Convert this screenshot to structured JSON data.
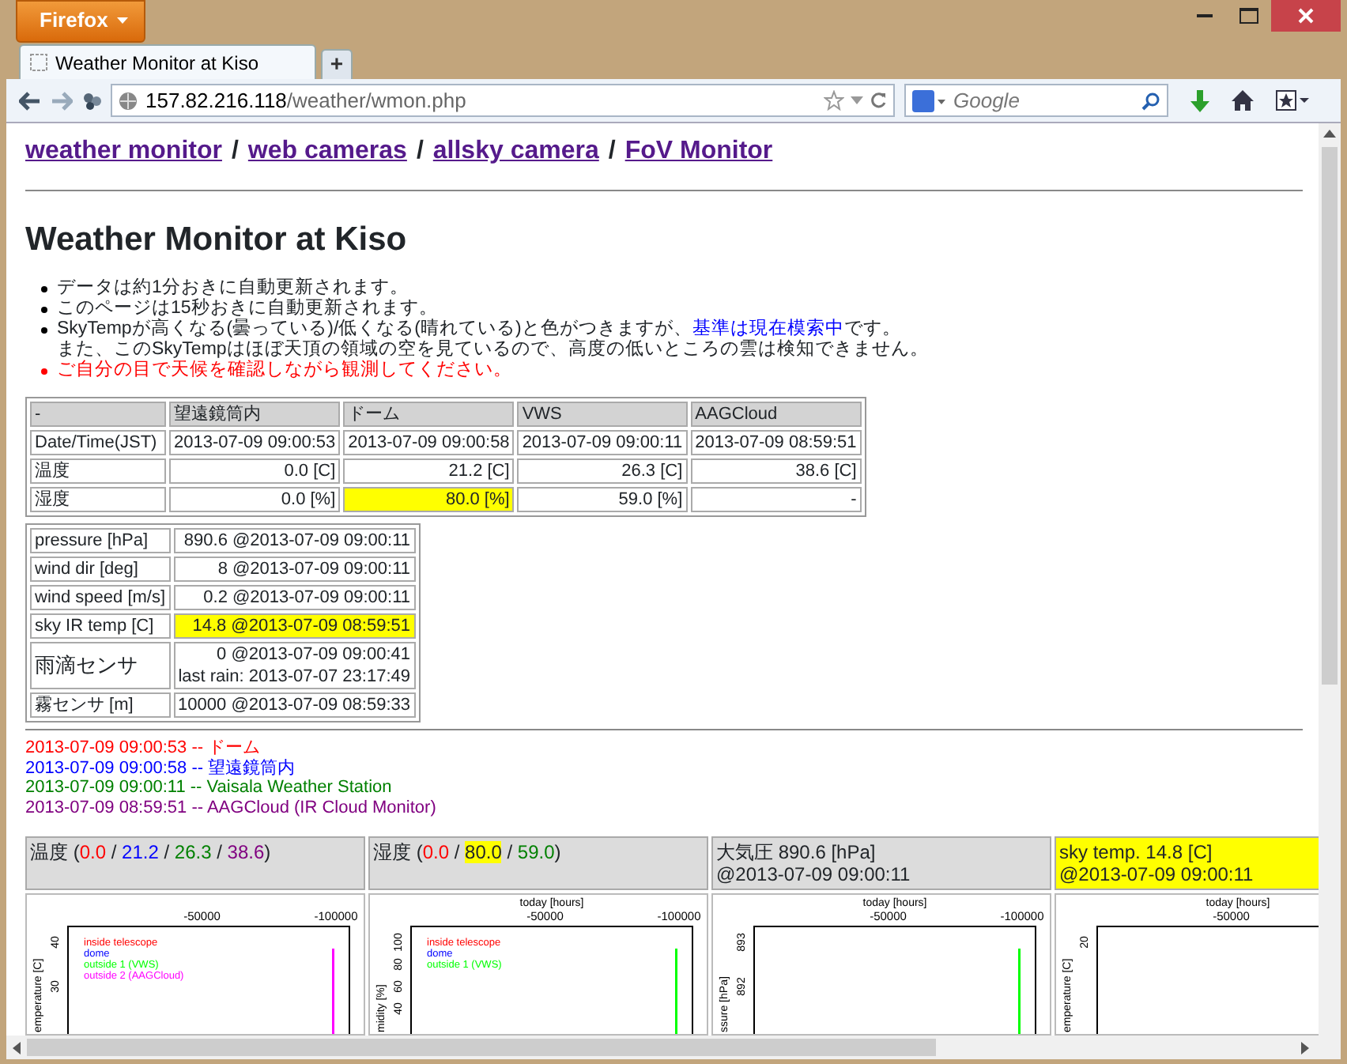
{
  "browser": {
    "menu_button": "Firefox",
    "tab": {
      "title": "Weather Monitor at Kiso",
      "selected": true
    },
    "new_tab": "+",
    "url_host": "157.82.216.118",
    "url_path": "/weather/wmon.php",
    "search_placeholder": "Google"
  },
  "nav": [
    {
      "kind": "link",
      "text": "weather monitor"
    },
    {
      "kind": "separator",
      "text": "/"
    },
    {
      "kind": "link",
      "text": "web cameras"
    },
    {
      "kind": "separator",
      "text": "/"
    },
    {
      "kind": "link",
      "text": "allsky camera"
    },
    {
      "kind": "separator",
      "text": "/"
    },
    {
      "kind": "link",
      "text": "FoV Monitor"
    }
  ],
  "heading": "Weather Monitor at Kiso",
  "notes": [
    {
      "kind": "plain",
      "lines": [
        [
          {
            "kind": "text",
            "text": "データは約1分おきに自動更新されます。"
          }
        ]
      ]
    },
    {
      "kind": "plain",
      "lines": [
        [
          {
            "kind": "text",
            "text": "このページは15秒おきに自動更新されます。"
          }
        ]
      ]
    },
    {
      "kind": "plain",
      "lines": [
        [
          {
            "kind": "text",
            "text": "SkyTempが高くなる(曇っている)/低くなる(晴れている)と色がつきますが、"
          },
          {
            "kind": "link",
            "text": "基準は現在模索中"
          },
          {
            "kind": "text",
            "text": "です。"
          }
        ],
        [
          {
            "kind": "text",
            "text": "また、このSkyTempはほぼ天頂の領域の空を見ているので、高度の低いところの雲は検知できません。"
          }
        ]
      ]
    },
    {
      "kind": "warning",
      "lines": [
        [
          {
            "kind": "text",
            "text": "ご自分の目で天候を確認しながら観測してください。"
          }
        ]
      ]
    }
  ],
  "sensor_table": {
    "columns": [
      "-",
      "望遠鏡筒内",
      "ドーム",
      "VWS",
      "AAGCloud"
    ],
    "rows": [
      {
        "cells": [
          {
            "text": "Date/Time(JST)",
            "highlighted": false
          },
          {
            "text": "2013-07-09 09:00:53",
            "highlighted": false
          },
          {
            "text": "2013-07-09 09:00:58",
            "highlighted": false
          },
          {
            "text": "2013-07-09 09:00:11",
            "highlighted": false
          },
          {
            "text": "2013-07-09 08:59:51",
            "highlighted": false
          }
        ]
      },
      {
        "cells": [
          {
            "text": "温度",
            "highlighted": false
          },
          {
            "text": "0.0 [C]",
            "highlighted": false
          },
          {
            "text": "21.2 [C]",
            "highlighted": false
          },
          {
            "text": "26.3 [C]",
            "highlighted": false
          },
          {
            "text": "38.6 [C]",
            "highlighted": false
          }
        ]
      },
      {
        "cells": [
          {
            "text": "湿度",
            "highlighted": false
          },
          {
            "text": "0.0 [%]",
            "highlighted": false
          },
          {
            "text": "80.0 [%]",
            "highlighted": true
          },
          {
            "text": "59.0 [%]",
            "highlighted": false
          },
          {
            "text": "-",
            "highlighted": false
          }
        ]
      }
    ]
  },
  "station_table": [
    {
      "label": "pressure [hPa]",
      "value": [
        "890.6 @2013-07-09 09:00:11"
      ],
      "highlighted": false
    },
    {
      "label": "wind dir [deg]",
      "value": [
        "8 @2013-07-09 09:00:11"
      ],
      "highlighted": false
    },
    {
      "label": "wind speed [m/s]",
      "value": [
        "0.2 @2013-07-09 09:00:11"
      ],
      "highlighted": false
    },
    {
      "label": "sky IR temp [C]",
      "value": [
        "14.8 @2013-07-09 08:59:51"
      ],
      "highlighted": true
    },
    {
      "label": "雨滴センサ",
      "value": [
        "0 @2013-07-09 09:00:41",
        "last rain: 2013-07-07 23:17:49"
      ],
      "highlighted": false
    },
    {
      "label": "霧センサ [m]",
      "value": [
        "10000 @2013-07-09 08:59:33"
      ],
      "highlighted": false
    }
  ],
  "log": [
    {
      "text": "2013-07-09 09:00:53 -- ドーム",
      "color": "#ff0000"
    },
    {
      "text": "2013-07-09 09:00:58 -- 望遠鏡筒内",
      "color": "#0000ff"
    },
    {
      "text": "2013-07-09 09:00:11 -- Vaisala Weather Station",
      "color": "#008000"
    },
    {
      "text": "2013-07-09 08:59:51 -- AAGCloud (IR Cloud Monitor)",
      "color": "#800080"
    }
  ],
  "panels": [
    {
      "highlighted": false,
      "header": [
        [
          {
            "text": "温度 ("
          },
          {
            "text": "0.0",
            "color": "#ff0000"
          },
          {
            "text": " / "
          },
          {
            "text": "21.2",
            "color": "#0000ff"
          },
          {
            "text": " / "
          },
          {
            "text": "26.3",
            "color": "#008000"
          },
          {
            "text": " / "
          },
          {
            "text": "38.6",
            "color": "#800080"
          },
          {
            "text": ")"
          }
        ]
      ],
      "plot": {
        "xticks": [
          "-50000",
          "-100000"
        ],
        "ylabel": "emperature [C]",
        "yticks": [
          "40",
          "30"
        ],
        "legend": [
          {
            "text": "inside telescope",
            "color": "#ff0000"
          },
          {
            "text": "dome",
            "color": "#0000ff"
          },
          {
            "text": "outside 1 (VWS)",
            "color": "#00ff00"
          },
          {
            "text": "outside 2 (AAGCloud)",
            "color": "#ff00ff"
          }
        ],
        "line": {
          "color": "#ff00ff"
        }
      }
    },
    {
      "highlighted": false,
      "header": [
        [
          {
            "text": "湿度 ("
          },
          {
            "text": "0.0",
            "color": "#ff0000"
          },
          {
            "text": " / "
          },
          {
            "text": "80.0",
            "marked": true
          },
          {
            "text": " / "
          },
          {
            "text": "59.0",
            "color": "#008000"
          },
          {
            "text": ")"
          }
        ]
      ],
      "plot": {
        "xlabel": "today [hours]",
        "xticks": [
          "-50000",
          "-100000"
        ],
        "ylabel": "midity [%]",
        "yticks": [
          "100",
          "80",
          "60",
          "40"
        ],
        "legend": [
          {
            "text": "inside telescope",
            "color": "#ff0000"
          },
          {
            "text": "dome",
            "color": "#0000ff"
          },
          {
            "text": "outside 1 (VWS)",
            "color": "#00ff00"
          }
        ],
        "line": {
          "color": "#00ff00"
        }
      }
    },
    {
      "highlighted": false,
      "header": [
        [
          {
            "text": "大気圧 890.6 [hPa]"
          }
        ],
        [
          {
            "text": "@2013-07-09 09:00:11"
          }
        ]
      ],
      "plot": {
        "xlabel": "today [hours]",
        "xticks": [
          "-50000",
          "-100000"
        ],
        "ylabel": "ssure [hPa]",
        "yticks": [
          "893",
          "892"
        ],
        "line": {
          "color": "#00ff00"
        }
      }
    },
    {
      "highlighted": true,
      "header": [
        [
          {
            "text": "sky temp. 14.8 [C]"
          }
        ],
        [
          {
            "text": "@2013-07-09 09:00:11"
          }
        ]
      ],
      "plot": {
        "xlabel": "today [hours]",
        "xticks": [
          "-50000"
        ],
        "ylabel": "emperature [C]",
        "yticks": [
          "20"
        ]
      }
    }
  ]
}
